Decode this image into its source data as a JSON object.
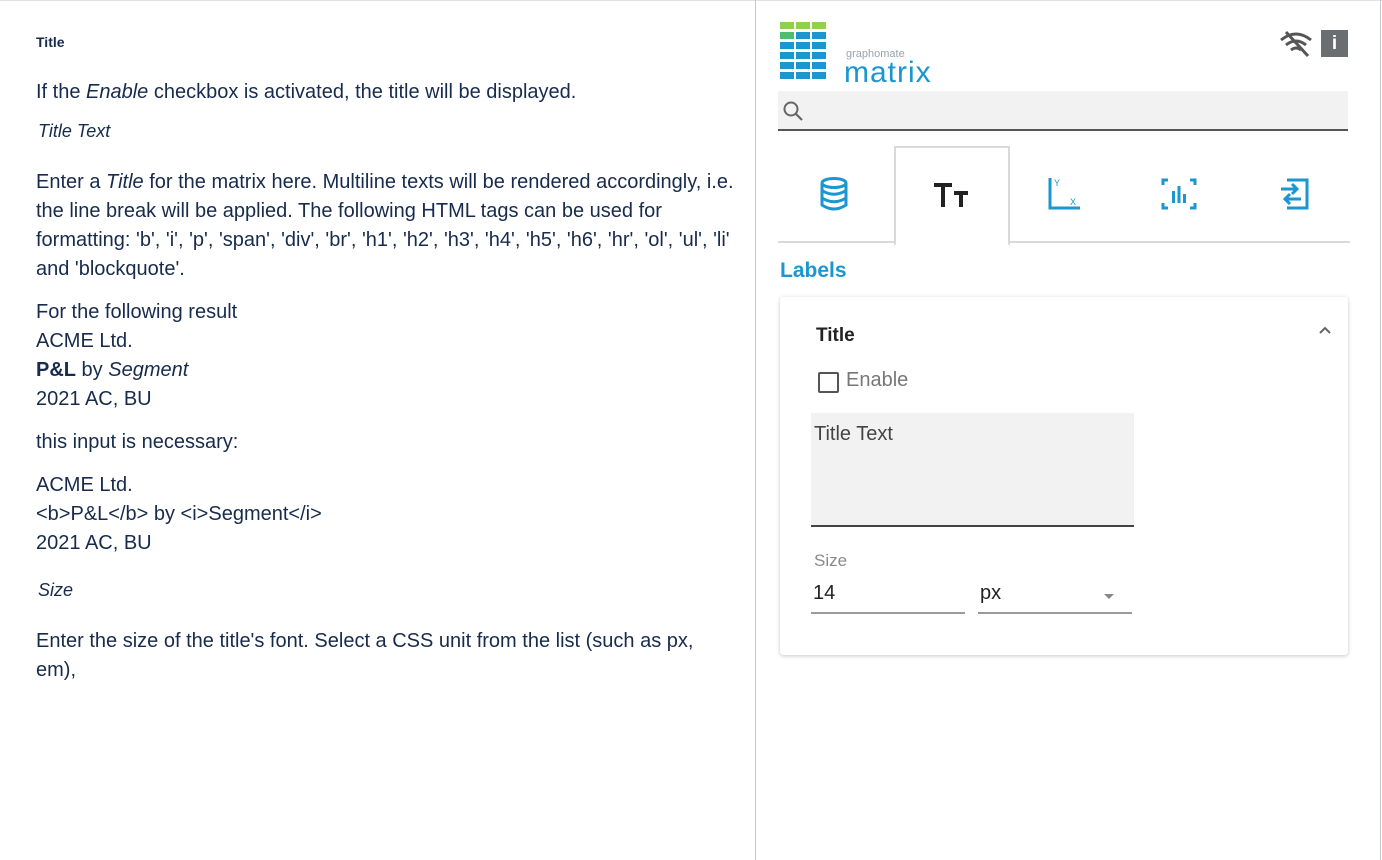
{
  "doc": {
    "heading": "Title",
    "p1_a": "If the ",
    "p1_em": "Enable",
    "p1_b": " checkbox is activated, the title will be displayed.",
    "sub_title_text": "Title Text",
    "p2_a": "Enter a ",
    "p2_em": "Title",
    "p2_b": " for the matrix here. Multiline texts will be rendered accordingly, i.e. the line break will be applied. The following HTML tags can be used for formatting: 'b', 'i', 'p', 'span', 'div', 'br', 'h1', 'h2', 'h3', 'h4', 'h5', 'h6', 'hr', 'ol', 'ul', 'li' and 'blockquote'.",
    "result_intro": "For the following result",
    "result_line1": "ACME Ltd.",
    "result_bold": "P&L",
    "result_by": " by ",
    "result_italic": "Segment",
    "result_line3": "2021 AC, BU",
    "input_intro": "this input is necessary:",
    "input_line1": "ACME Ltd.",
    "input_line2": "<b>P&L</b> by <i>Segment</i>",
    "input_line3": "2021 AC, BU",
    "sub_size": "Size",
    "p3": "Enter the size of the title's font. Select a CSS unit from the list (such as px, em),"
  },
  "panel": {
    "logo_small": "graphomate",
    "logo_big": "matrix",
    "info_label": "i",
    "search": {
      "placeholder": ""
    },
    "tabs": [
      {
        "icon": "database-icon"
      },
      {
        "icon": "text-format-icon",
        "active": true
      },
      {
        "icon": "axis-icon"
      },
      {
        "icon": "chart-bars-icon"
      },
      {
        "icon": "import-icon"
      }
    ],
    "section_label": "Labels",
    "card": {
      "title": "Title",
      "enable_label": "Enable",
      "enable_checked": false,
      "textarea_placeholder": "Title Text",
      "size_label": "Size",
      "size_value": "14",
      "unit_value": "px"
    }
  },
  "colors": {
    "accent": "#1a96d0",
    "logo_light": "#8fd14f",
    "logo_dark": "#1a96d0"
  }
}
